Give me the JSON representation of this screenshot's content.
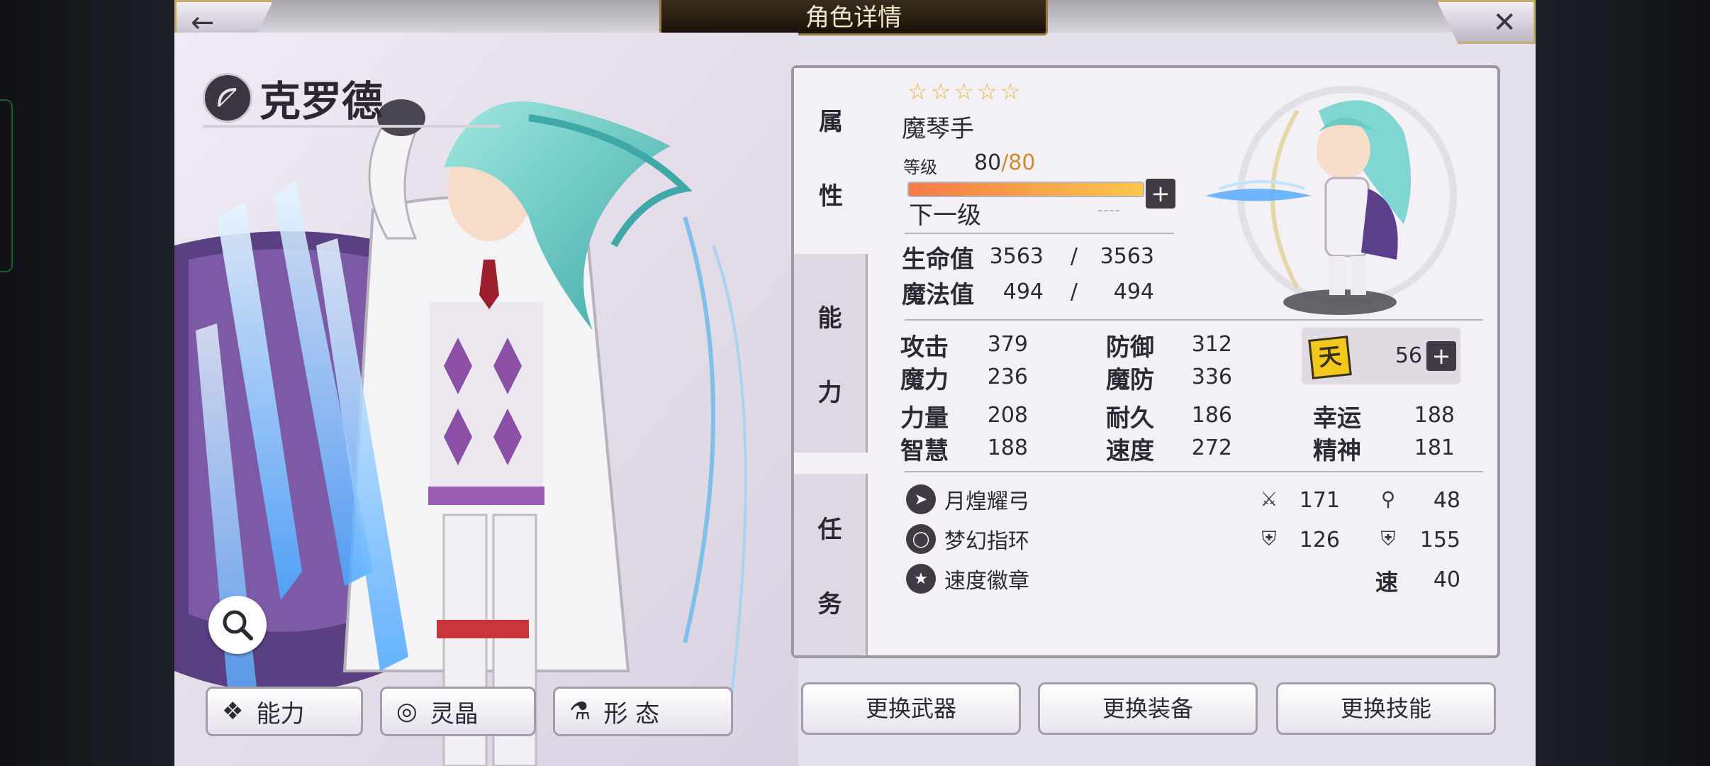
{
  "header": {
    "title": "角色详情",
    "back_icon": "back-arrow-icon",
    "close_icon": "close-icon"
  },
  "character": {
    "name": "克罗德",
    "stars": "☆☆☆☆☆",
    "job": "魔琴手"
  },
  "level": {
    "label": "等级",
    "current": "80",
    "max": "80",
    "progress": 1.0,
    "next_label": "下一级",
    "next_value": "----"
  },
  "side_tabs": [
    {
      "chars": [
        "属",
        "性"
      ]
    },
    {
      "chars": [
        "能",
        "力"
      ]
    },
    {
      "chars": [
        "任",
        "务"
      ]
    }
  ],
  "vitals": [
    {
      "label": "生命值",
      "current": "3563",
      "sep": "/",
      "max": "3563"
    },
    {
      "label": "魔法值",
      "current": "494",
      "sep": "/",
      "max": "494"
    }
  ],
  "stats": [
    {
      "label": "攻击",
      "value": "379"
    },
    {
      "label": "防御",
      "value": "312"
    },
    {
      "label": "魔力",
      "value": "236"
    },
    {
      "label": "魔防",
      "value": "336"
    },
    {
      "label": "力量",
      "value": "208"
    },
    {
      "label": "耐久",
      "value": "186"
    },
    {
      "label": "幸运",
      "value": "188"
    },
    {
      "label": "智慧",
      "value": "188"
    },
    {
      "label": "速度",
      "value": "272"
    },
    {
      "label": "精神",
      "value": "181"
    }
  ],
  "awaken": {
    "icon_text": "天",
    "value": "56"
  },
  "equipment": [
    {
      "name": "月煌耀弓",
      "icon": "bow-icon"
    },
    {
      "name": "梦幻指环",
      "icon": "ring-icon"
    },
    {
      "name": "速度徽章",
      "icon": "badge-icon"
    }
  ],
  "equip_stats": [
    {
      "icon": "sword-icon",
      "value": "171"
    },
    {
      "icon": "staff-icon",
      "value": "48"
    },
    {
      "icon": "shield-icon",
      "value": "126"
    },
    {
      "icon": "magic-shield-icon",
      "value": "155"
    },
    {
      "label": "速",
      "value": "40"
    }
  ],
  "bottom_tabs": [
    {
      "label": "能力",
      "icon": "ability-icon"
    },
    {
      "label": "灵晶",
      "icon": "crystal-icon"
    },
    {
      "label": "形 态",
      "icon": "form-icon"
    }
  ],
  "actions": [
    {
      "label": "更换武器"
    },
    {
      "label": "更换装备"
    },
    {
      "label": "更换技能"
    }
  ],
  "colors": {
    "accent": "#d08b2f",
    "panel_bg": "#f3f0f6",
    "dark": "#2e2a33",
    "hair": "#6fd0c8",
    "cape": "#6a4a8a",
    "ice": "#7fc6ff"
  }
}
